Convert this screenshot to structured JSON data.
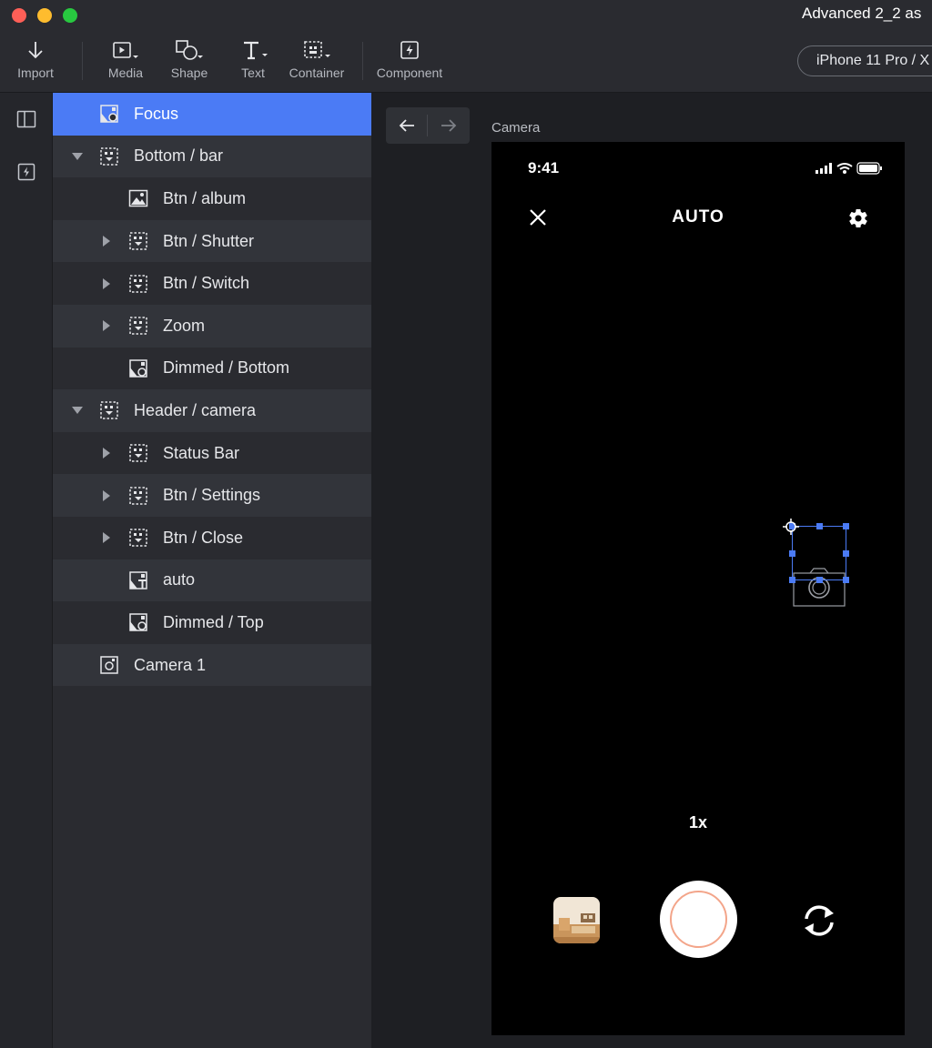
{
  "window": {
    "title": "Advanced 2_2 as"
  },
  "toolbar": {
    "import_label": "Import",
    "media_label": "Media",
    "shape_label": "Shape",
    "text_label": "Text",
    "container_label": "Container",
    "component_label": "Component",
    "device_label": "iPhone 11 Pro / X"
  },
  "layers": [
    {
      "name": "Focus",
      "depth": 0,
      "icon": "image-layer-icon",
      "expand": "none",
      "selected": true
    },
    {
      "name": "Bottom / bar",
      "depth": 0,
      "icon": "container-icon",
      "expand": "expanded"
    },
    {
      "name": "Btn / album",
      "depth": 1,
      "icon": "image-icon",
      "expand": "none"
    },
    {
      "name": "Btn / Shutter",
      "depth": 1,
      "icon": "container-icon",
      "expand": "collapsed"
    },
    {
      "name": "Btn / Switch",
      "depth": 1,
      "icon": "container-icon",
      "expand": "collapsed"
    },
    {
      "name": "Zoom",
      "depth": 1,
      "icon": "container-icon",
      "expand": "collapsed"
    },
    {
      "name": "Dimmed / Bottom",
      "depth": 1,
      "icon": "image-layer-icon",
      "expand": "none"
    },
    {
      "name": "Header / camera",
      "depth": 0,
      "icon": "container-icon",
      "expand": "expanded"
    },
    {
      "name": "Status Bar",
      "depth": 1,
      "icon": "container-icon",
      "expand": "collapsed"
    },
    {
      "name": "Btn / Settings",
      "depth": 1,
      "icon": "container-icon",
      "expand": "collapsed"
    },
    {
      "name": "Btn / Close",
      "depth": 1,
      "icon": "container-icon",
      "expand": "collapsed"
    },
    {
      "name": "auto",
      "depth": 1,
      "icon": "text-layer-icon",
      "expand": "none"
    },
    {
      "name": "Dimmed / Top",
      "depth": 1,
      "icon": "image-layer-icon",
      "expand": "none"
    },
    {
      "name": "Camera 1",
      "depth": 0,
      "icon": "camera-layer-icon",
      "expand": "none"
    }
  ],
  "canvas": {
    "frame_label": "Camera",
    "phone": {
      "time": "9:41",
      "mode": "AUTO",
      "zoom": "1x"
    }
  },
  "colors": {
    "accent": "#4b7bf5",
    "shutter_ring": "#f3a58a"
  }
}
